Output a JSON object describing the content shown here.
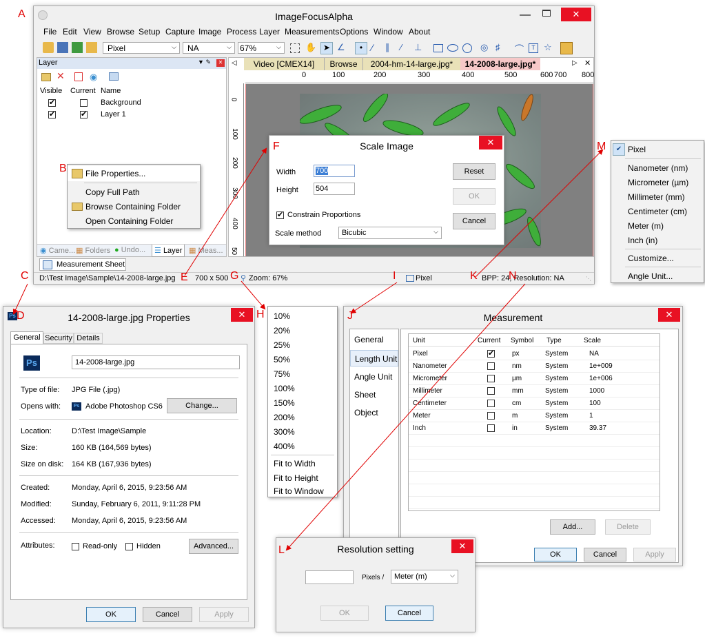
{
  "labels": [
    "A",
    "B",
    "C",
    "D",
    "E",
    "F",
    "G",
    "H",
    "I",
    "J",
    "K",
    "L",
    "M",
    "N"
  ],
  "main": {
    "title": "ImageFocusAlpha",
    "menu": [
      "File",
      "Edit",
      "View",
      "Browse",
      "Setup",
      "Capture",
      "Image",
      "Process",
      "Layer",
      "Measurements",
      "Options",
      "Window",
      "About"
    ],
    "toolbar": {
      "unit": "Pixel",
      "na": "NA",
      "zoom": "67%"
    },
    "tabs": [
      "Video [CMEX14]",
      "Browse",
      "2004-hm-14-large.jpg*",
      "14-2008-large.jpg*"
    ],
    "ruler_x": [
      "0",
      "100",
      "200",
      "300",
      "400",
      "500",
      "600",
      "700",
      "800"
    ],
    "ruler_y": [
      "0",
      "100",
      "200",
      "300",
      "400",
      "50"
    ],
    "status": {
      "path": "D:\\Test Image\\Sample\\14-2008-large.jpg",
      "size": "700 x 500",
      "zoom": "Zoom: 67%",
      "unit": "Pixel",
      "bpp": "BPP: 24, Resolution: NA"
    }
  },
  "layer_panel": {
    "title": "Layer",
    "headers": [
      "Visible",
      "Current",
      "Name"
    ],
    "rows": [
      {
        "visible": true,
        "current": false,
        "name": "Background"
      },
      {
        "visible": true,
        "current": true,
        "name": "Layer 1"
      }
    ],
    "bottom_tabs": [
      "Came...",
      "Folders",
      "Undo...",
      "Layer",
      "Meas..."
    ],
    "sheet_tab": "Measurement Sheet"
  },
  "context_menu": [
    "File Properties...",
    "Copy Full Path",
    "Browse Containing Folder",
    "Open Containing Folder"
  ],
  "scale_image": {
    "title": "Scale Image",
    "width_label": "Width",
    "width": "700",
    "height_label": "Height",
    "height": "504",
    "constrain": "Constrain Proportions",
    "method_label": "Scale method",
    "method": "Bicubic",
    "reset": "Reset",
    "ok": "OK",
    "cancel": "Cancel"
  },
  "unit_menu": [
    "Pixel",
    "Nanometer (nm)",
    "Micrometer (µm)",
    "Millimeter (mm)",
    "Centimeter (cm)",
    "Meter (m)",
    "Inch (in)",
    "Customize...",
    "Angle Unit..."
  ],
  "zoom_menu": [
    "10%",
    "20%",
    "25%",
    "50%",
    "75%",
    "100%",
    "150%",
    "200%",
    "300%",
    "400%",
    "Fit to Width",
    "Fit to Height",
    "Fit to Window"
  ],
  "properties": {
    "title": "14-2008-large.jpg Properties",
    "tabs": [
      "General",
      "Security",
      "Details"
    ],
    "filename": "14-2008-large.jpg",
    "type_label": "Type of file:",
    "type": "JPG File (.jpg)",
    "opens_label": "Opens with:",
    "opens": "Adobe Photoshop CS6",
    "change": "Change...",
    "location_label": "Location:",
    "location": "D:\\Test Image\\Sample",
    "size_label": "Size:",
    "size": "160 KB (164,569 bytes)",
    "disk_label": "Size on disk:",
    "disk": "164 KB (167,936 bytes)",
    "created_label": "Created:",
    "created": "Monday, April 6, 2015, 9:23:56 AM",
    "modified_label": "Modified:",
    "modified": "Sunday, February 6, 2011, 9:11:28 PM",
    "accessed_label": "Accessed:",
    "accessed": "Monday, April 6, 2015, 9:23:56 AM",
    "attr_label": "Attributes:",
    "readonly": "Read-only",
    "hidden": "Hidden",
    "advanced": "Advanced...",
    "ok": "OK",
    "cancel": "Cancel",
    "apply": "Apply",
    "ps": "Ps"
  },
  "measurement": {
    "title": "Measurement",
    "nav": [
      "General",
      "Length Unit",
      "Angle Unit",
      "Sheet",
      "Object"
    ],
    "headers": [
      "Unit",
      "Current",
      "Symbol",
      "Type",
      "Scale"
    ],
    "rows": [
      {
        "unit": "Pixel",
        "current": true,
        "symbol": "px",
        "type": "System",
        "scale": "NA"
      },
      {
        "unit": "Nanometer",
        "current": false,
        "symbol": "nm",
        "type": "System",
        "scale": "1e+009"
      },
      {
        "unit": "Micrometer",
        "current": false,
        "symbol": "µm",
        "type": "System",
        "scale": "1e+006"
      },
      {
        "unit": "Millimeter",
        "current": false,
        "symbol": "mm",
        "type": "System",
        "scale": "1000"
      },
      {
        "unit": "Centimeter",
        "current": false,
        "symbol": "cm",
        "type": "System",
        "scale": "100"
      },
      {
        "unit": "Meter",
        "current": false,
        "symbol": "m",
        "type": "System",
        "scale": "1"
      },
      {
        "unit": "Inch",
        "current": false,
        "symbol": "in",
        "type": "System",
        "scale": "39.37"
      }
    ],
    "add": "Add...",
    "delete": "Delete",
    "ok": "OK",
    "cancel": "Cancel",
    "apply": "Apply"
  },
  "resolution": {
    "title": "Resolution setting",
    "value": "",
    "per": "Pixels /",
    "unit": "Meter (m)",
    "ok": "OK",
    "cancel": "Cancel"
  },
  "colors": {
    "accent": "#e00000",
    "tab_active": "#f6c8c8",
    "tab_inactive": "#e9e1b8",
    "close": "#e81123"
  }
}
